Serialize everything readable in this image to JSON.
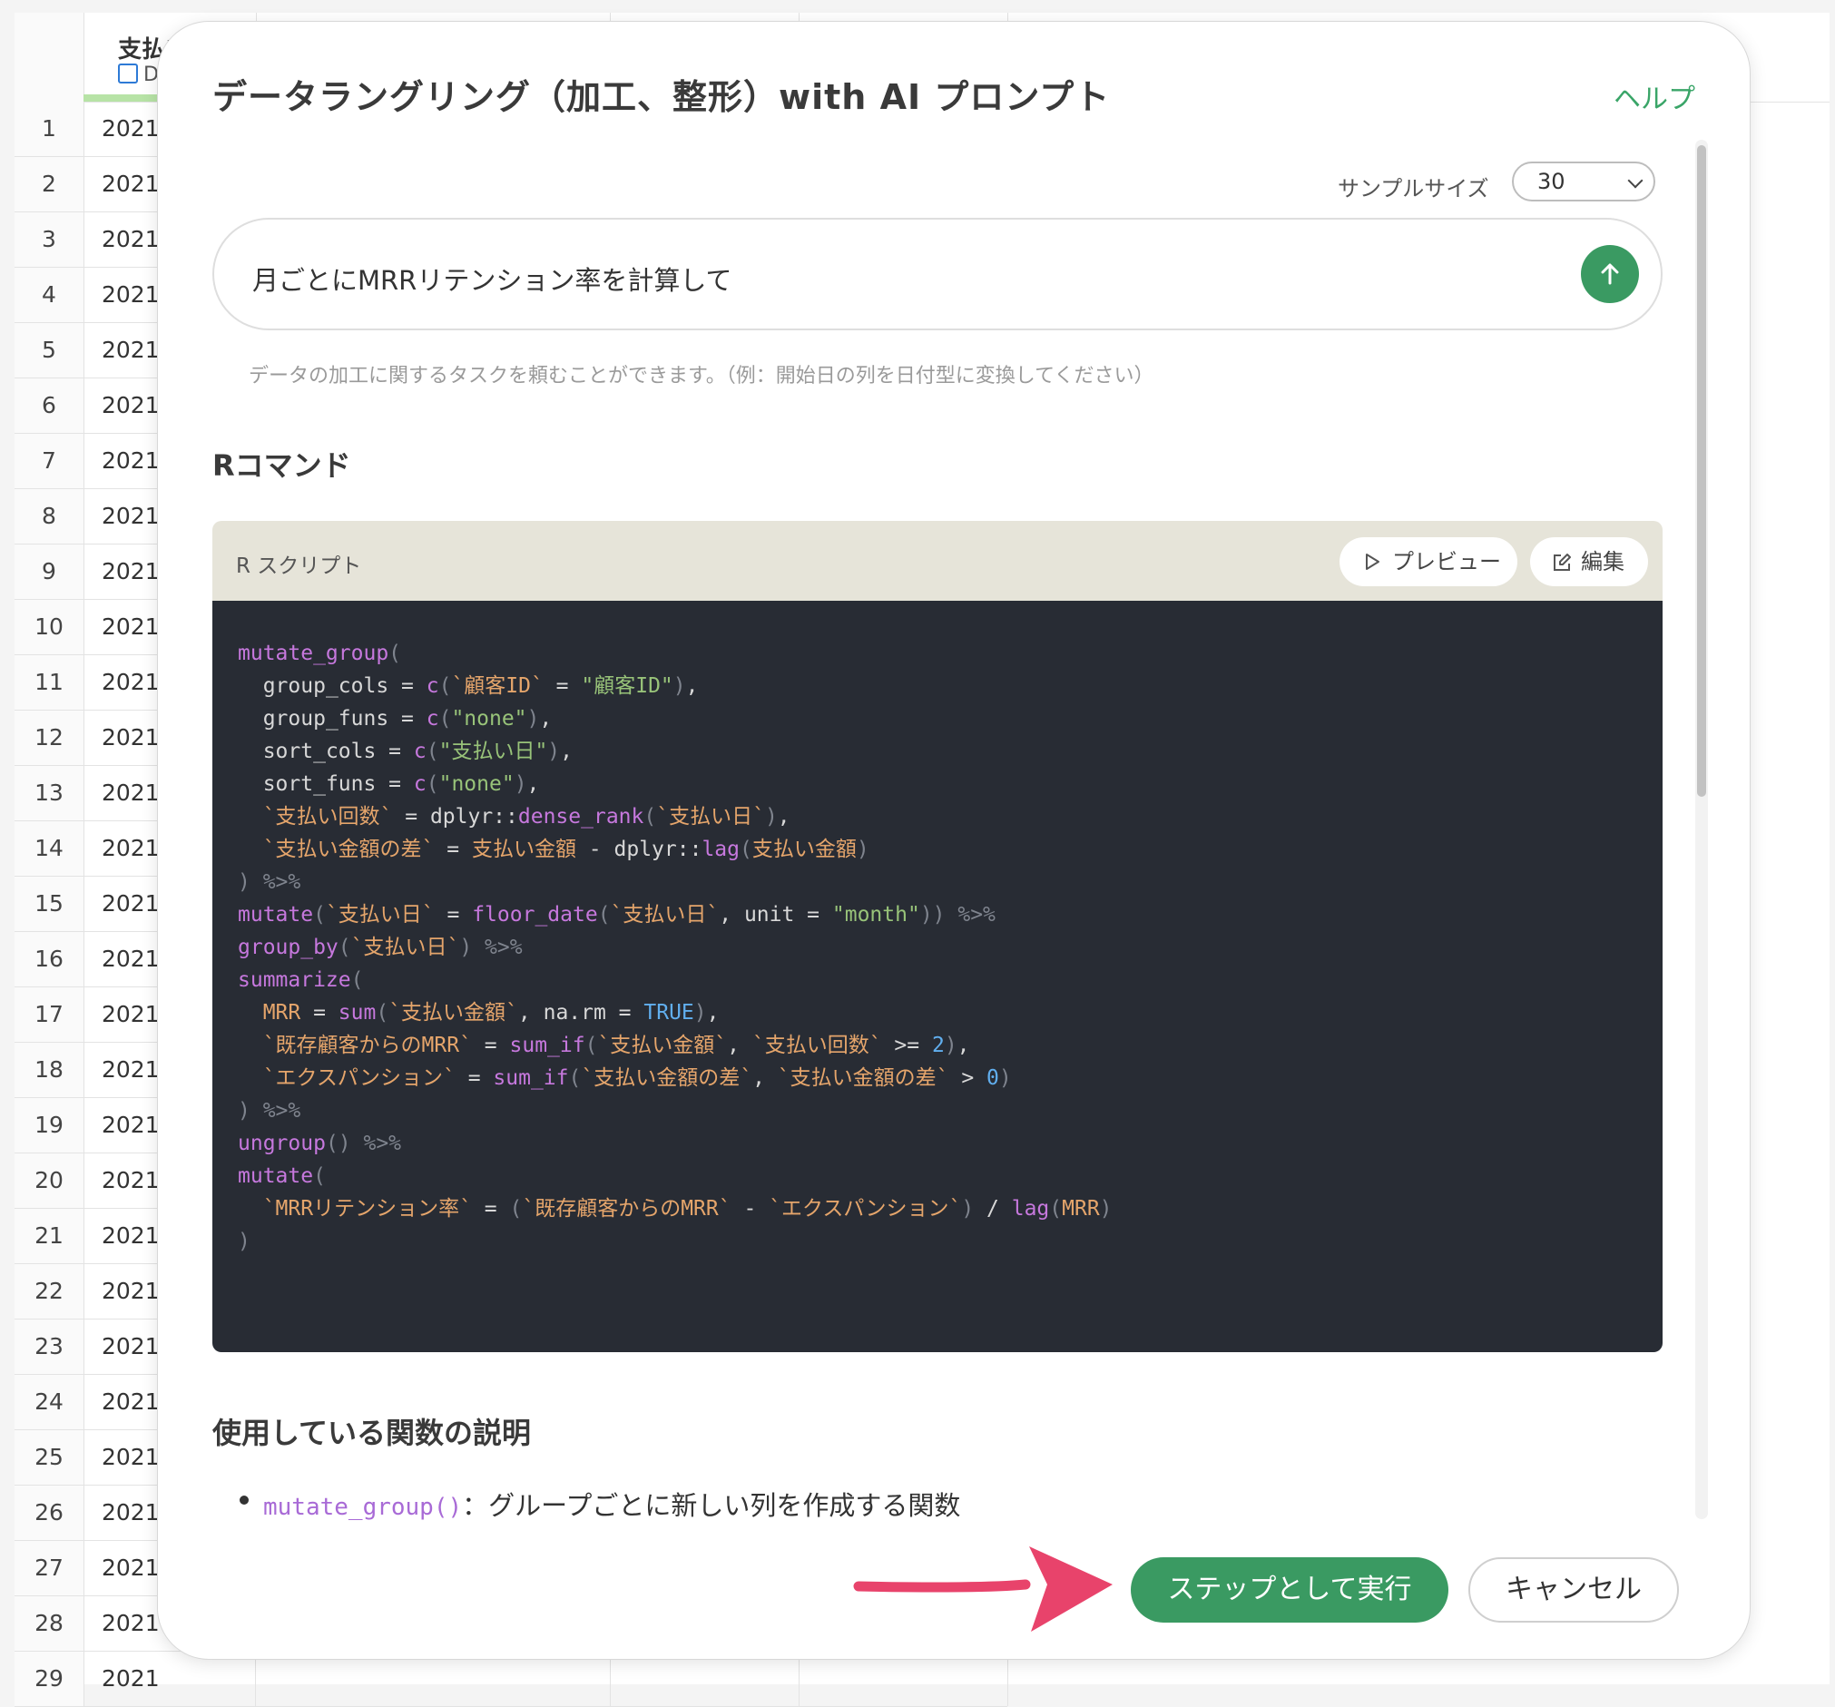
{
  "table": {
    "column_title": "支払い",
    "column_type": "Da",
    "row_numbers": [
      "1",
      "2",
      "3",
      "4",
      "5",
      "6",
      "7",
      "8",
      "9",
      "10",
      "11",
      "12",
      "13",
      "14",
      "15",
      "16",
      "17",
      "18",
      "19",
      "20",
      "21",
      "22",
      "23",
      "24",
      "25",
      "26",
      "27",
      "28",
      "29"
    ],
    "date_prefix": "2021"
  },
  "dialog": {
    "title": "データラングリング（加工、整形）with AI プロンプト",
    "help": "ヘルプ",
    "sample_label": "サンプルサイズ",
    "sample_value": "30",
    "prompt_text": "月ごとにMRRリテンション率を計算して",
    "hint": "データの加工に関するタスクを頼むことができます。（例：開始日の列を日付型に変換してください）",
    "section_r": "Rコマンド",
    "script_label": "R スクリプト",
    "preview_label": "プレビュー",
    "edit_label": "編集",
    "section_funcs": "使用している関数の説明",
    "func_item_name": "mutate_group()",
    "func_item_desc": "：グループごとに新しい列を作成する関数",
    "run_button": "ステップとして実行",
    "cancel_button": "キャンセル"
  },
  "colors": {
    "accent_green": "#3a9a62",
    "arrow_pink": "#e8436b",
    "code_bg": "#282c34"
  },
  "icons": [
    "calendar-icon",
    "chevron-down-icon",
    "arrow-up-icon",
    "play-icon",
    "edit-icon",
    "pointer-arrow"
  ]
}
